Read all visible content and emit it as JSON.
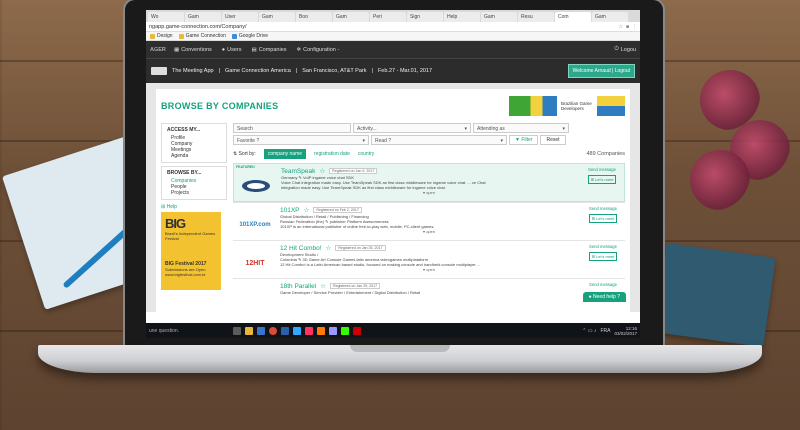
{
  "browser": {
    "tabs": [
      "Wo",
      "Gam",
      "User",
      "Gam",
      "Boo",
      "Gam",
      "Peri",
      "Sign",
      "Help",
      "Gam",
      "Resu",
      "Com",
      "Gam"
    ],
    "url": "ngapp.game-connection.com/Company/",
    "bookmarks": [
      "Design",
      "Game Connection",
      "Google Drive"
    ]
  },
  "adminbar": {
    "brand": "AGER",
    "items": [
      "Conventions",
      "Users",
      "Companies",
      "Configuration -"
    ],
    "logout": "Logou"
  },
  "header": {
    "app": "The Meeting App",
    "event": "Game Connection America",
    "venue": "San Francisco, AT&T Park",
    "dates": "Feb.27 - Mar.01, 2017",
    "welcome": "Welcome Arnaud | Logout"
  },
  "page": {
    "title": "BROWSE BY COMPANIES",
    "banner_text": "Brazilian Game Developers"
  },
  "sidebar": {
    "access_title": "ACCESS MY...",
    "access_items": [
      "Profile",
      "Company",
      "Meetings",
      "Agenda"
    ],
    "browse_title": "BROWSE BY...",
    "browse_items": [
      "Companies",
      "People",
      "Projects"
    ],
    "help": "Help",
    "ad_big": "BIG",
    "ad_sub": "Brazil's Independent Games Festival",
    "ad_fest": "BIG Festival 2017",
    "ad_open": "Submissions are Open",
    "ad_url": "www.bigfestival.com.br"
  },
  "filters": {
    "search": "Search",
    "activity": "Activity...",
    "attending": "Attending as",
    "favorite": "Favorite ?",
    "read": "Read ?",
    "filter_btn": "Filter",
    "reset_btn": "Reset",
    "sort_label": "Sort by:",
    "sort_active": "company name",
    "sort_reg": "registration date",
    "sort_country": "country",
    "count": "489 Companies"
  },
  "companies": [
    {
      "featured": "FEATURED",
      "name": "TeamSpeak",
      "registered": "Registered on Jan 9, 2017",
      "line1": "Germany ✎ VoIP ingame voice chat SDK",
      "line2": "Voice Chat integration made easy. Use TeamSpeak SDK as first class middleware for ingame voice chat. ... ce Chat",
      "line3": "integration made easy. Use TeamSpeak SDK as first class middleware for ingame voice chat.",
      "send": "Send message",
      "meet": "Let's meet",
      "open": "open"
    },
    {
      "name": "101XP",
      "registered": "Registered on Feb 2, 2017",
      "line1": "Global Distribution / Retail / Publishing / Financing",
      "line2": "Russian Federation (the) ✎ publisher Platform Awesomeness",
      "line3": "101XP is an international publisher of online free-to-play web, mobile, PC-client games.",
      "send": "Send message",
      "meet": "Let's meet",
      "open": "open"
    },
    {
      "name": "12 Hit Combo!",
      "registered": "Registered on Jan 26, 2017",
      "line1": "Development Studio /",
      "line2": "Colombia ✎ 3D Game Art Console Games latin america videogames multiplataform",
      "line3": "12 Hit Combo! is a Latin American based studio, focused on making console and handheld console multiplayer ...",
      "send": "Send message",
      "meet": "Let's meet",
      "open": "open"
    },
    {
      "name": "18th Parallel",
      "registered": "Registered on Jan 25, 2017",
      "line1": "Game Developer / Service Provider / Entertainment / Digital Distribution / Retail",
      "send": "Send message"
    }
  ],
  "taskbar": {
    "search": "une question.",
    "lang": "FRA",
    "time": "12:16",
    "date": "03/02/2017"
  },
  "needhelp": "Need help ?"
}
